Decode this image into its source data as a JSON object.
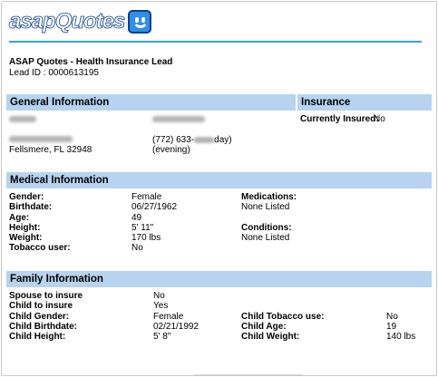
{
  "brand": {
    "logo_text": "asapQuotes"
  },
  "header": {
    "title": "ASAP Quotes - Health Insurance Lead",
    "lead_id": "Lead ID : 0000613195"
  },
  "general": {
    "heading": "General Information",
    "city": "Fellsmere, FL 32948",
    "phone_day": "(772) 633-",
    "phone_day_suffix": "day)",
    "phone_evening": "(evening)"
  },
  "insurance": {
    "heading": "Insurance",
    "currently_insured_label": "Currently Insured:",
    "currently_insured_value": "No"
  },
  "medical": {
    "heading": "Medical Information",
    "rows": [
      {
        "label": "Gender:",
        "value": "Female"
      },
      {
        "label": "Birthdate:",
        "value": "06/27/1962"
      },
      {
        "label": "Age:",
        "value": "49"
      },
      {
        "label": "Height:",
        "value": "5' 11\""
      },
      {
        "label": "Weight:",
        "value": "170 lbs"
      },
      {
        "label": "Tobacco user:",
        "value": "No"
      }
    ],
    "medications_label": "Medications:",
    "medications_value": "None Listed",
    "conditions_label": "Conditions:",
    "conditions_value": "None Listed"
  },
  "family": {
    "heading": "Family Information",
    "left": [
      {
        "label": "Spouse to insure",
        "value": "No"
      },
      {
        "label": "Child to insure",
        "value": "Yes"
      },
      {
        "label": "Child Gender:",
        "value": "Female"
      },
      {
        "label": "Child Birthdate:",
        "value": "02/21/1992"
      },
      {
        "label": "Child Height:",
        "value": "5' 8\""
      }
    ],
    "right": [
      {
        "label": "Child Tobacco use:",
        "value": "No"
      },
      {
        "label": "Child Age:",
        "value": "19"
      },
      {
        "label": "Child Weight:",
        "value": "140 lbs"
      }
    ]
  },
  "colors": {
    "accent_rule": "#2aa6e8",
    "section_bar": "#b7d3ef",
    "logo_blue": "#0a4fb4"
  },
  "icons": {
    "logo_mark": "smiley-face-icon"
  }
}
